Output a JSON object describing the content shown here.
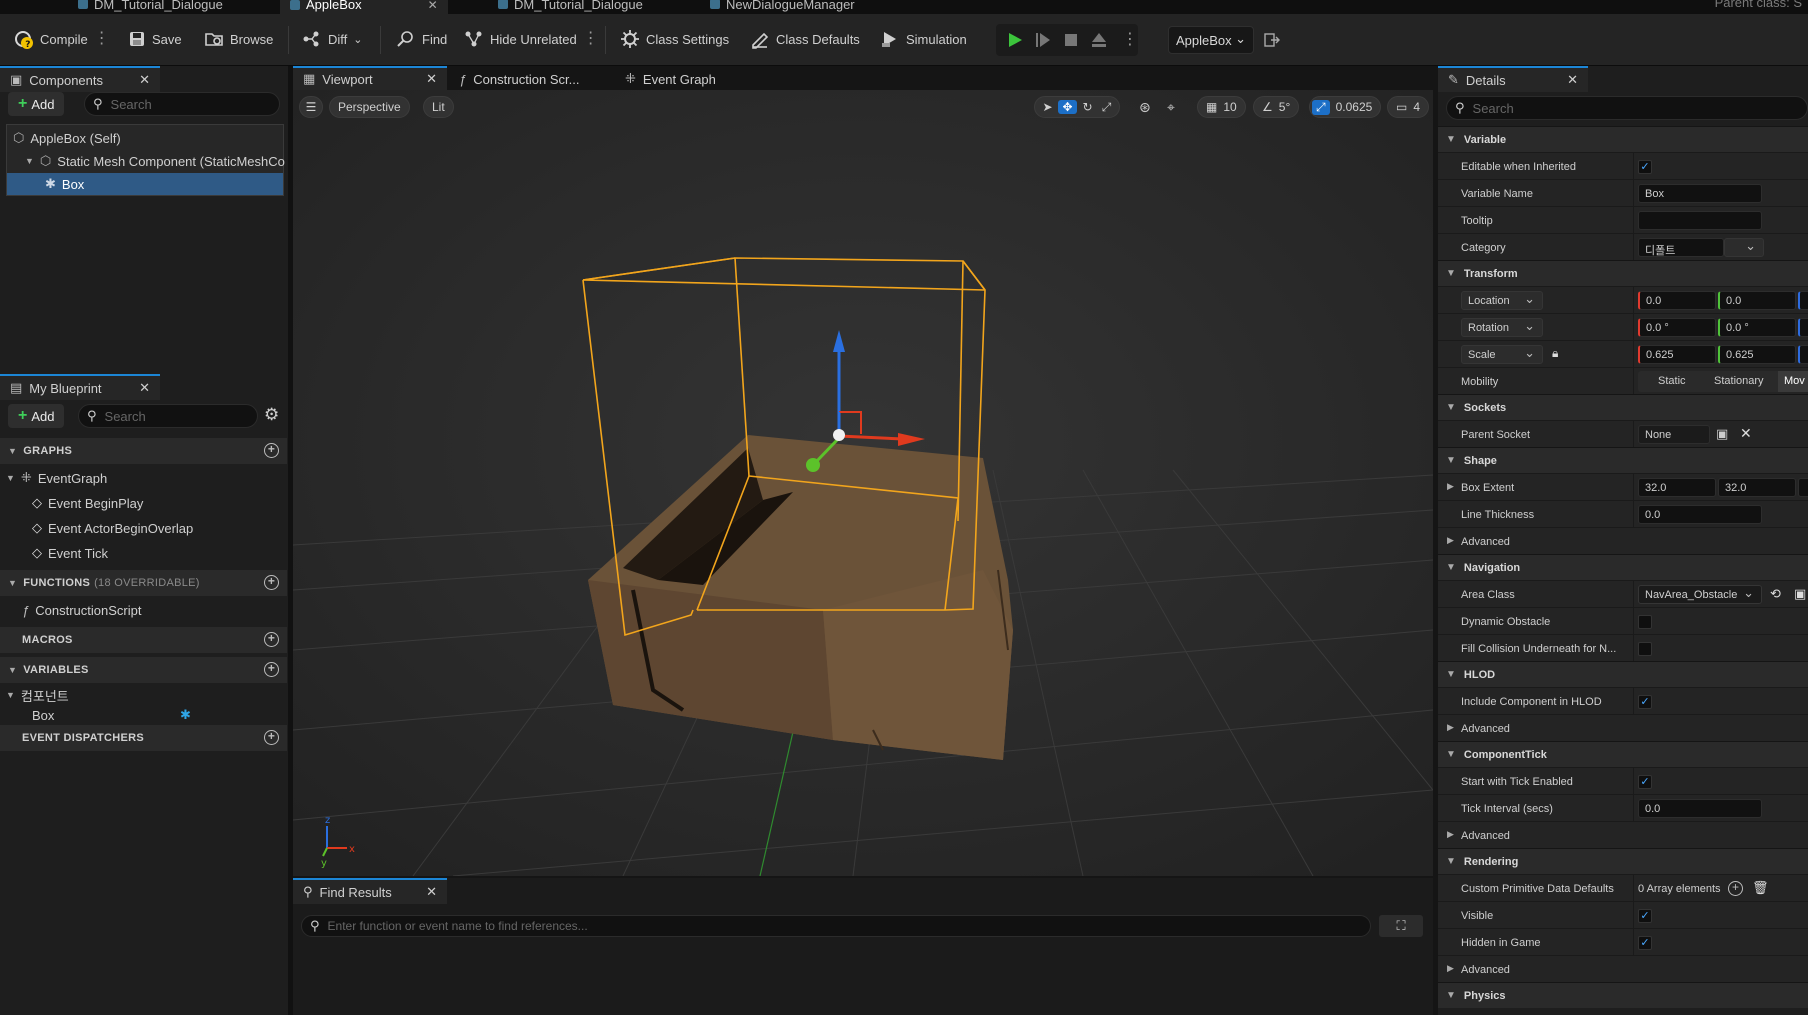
{
  "tabs": [
    {
      "label": "DM_Tutorial_Dialogue",
      "active": false
    },
    {
      "label": "AppleBox",
      "active": true
    },
    {
      "label": "DM_Tutorial_Dialogue",
      "active": false
    },
    {
      "label": "NewDialogueManager",
      "active": false
    }
  ],
  "parent_class": "Parent class: S",
  "toolbar": {
    "compile": "Compile",
    "save": "Save",
    "browse": "Browse",
    "diff": "Diff",
    "find": "Find",
    "hide_unrelated": "Hide Unrelated",
    "class_settings": "Class Settings",
    "class_defaults": "Class Defaults",
    "simulation": "Simulation",
    "debug_object": "AppleBox"
  },
  "components": {
    "tab": "Components",
    "add": "Add",
    "search_placeholder": "Search",
    "items": [
      "AppleBox (Self)",
      "Static Mesh Component (StaticMeshCo",
      "Box"
    ]
  },
  "my_blueprint": {
    "tab": "My Blueprint",
    "add": "Add",
    "search_placeholder": "Search",
    "graphs_header": "GRAPHS",
    "event_graph": "EventGraph",
    "events": [
      "Event BeginPlay",
      "Event ActorBeginOverlap",
      "Event Tick"
    ],
    "functions_header": "FUNCTIONS",
    "functions_note": "(18 OVERRIDABLE)",
    "construction_script": "ConstructionScript",
    "macros_header": "MACROS",
    "variables_header": "VARIABLES",
    "variable_category": "컴포넌트",
    "variable_box": "Box",
    "dispatchers_header": "EVENT DISPATCHERS"
  },
  "editor_tabs": {
    "viewport": "Viewport",
    "construction": "Construction Scr...",
    "event_graph": "Event Graph"
  },
  "viewport": {
    "perspective": "Perspective",
    "lit": "Lit",
    "grid_size": "10",
    "angle_snap": "5°",
    "scale_snap": "0.0625",
    "camera_speed": "4"
  },
  "find_results": {
    "tab": "Find Results",
    "placeholder": "Enter function or event name to find references..."
  },
  "details": {
    "tab": "Details",
    "search_placeholder": "Search",
    "variable_header": "Variable",
    "editable_label": "Editable when Inherited",
    "variable_name_label": "Variable Name",
    "variable_name_value": "Box",
    "tooltip_label": "Tooltip",
    "category_label": "Category",
    "category_value": "디폴트",
    "transform_header": "Transform",
    "location_label": "Location",
    "location_x": "0.0",
    "location_y": "0.0",
    "rotation_label": "Rotation",
    "rotation_x": "0.0 °",
    "rotation_y": "0.0 °",
    "scale_label": "Scale",
    "scale_x": "0.625",
    "scale_y": "0.625",
    "mobility_label": "Mobility",
    "mobility_static": "Static",
    "mobility_stationary": "Stationary",
    "mobility_movable": "Mov",
    "sockets_header": "Sockets",
    "parent_socket_label": "Parent Socket",
    "parent_socket_value": "None",
    "shape_header": "Shape",
    "box_extent_label": "Box Extent",
    "box_extent_x": "32.0",
    "box_extent_y": "32.0",
    "line_thickness_label": "Line Thickness",
    "line_thickness_value": "0.0",
    "advanced_label": "Advanced",
    "navigation_header": "Navigation",
    "area_class_label": "Area Class",
    "area_class_value": "NavArea_Obstacle",
    "dynamic_obstacle_label": "Dynamic Obstacle",
    "fill_collision_label": "Fill Collision Underneath for N...",
    "hlod_header": "HLOD",
    "include_hlod_label": "Include Component in HLOD",
    "component_tick_header": "ComponentTick",
    "start_tick_label": "Start with Tick Enabled",
    "tick_interval_label": "Tick Interval (secs)",
    "tick_interval_value": "0.0",
    "rendering_header": "Rendering",
    "custom_primitive_label": "Custom Primitive Data Defaults",
    "custom_primitive_value": "0 Array elements",
    "visible_label": "Visible",
    "hidden_in_game_label": "Hidden in Game",
    "physics_header": "Physics"
  },
  "checkbox_mark": "✓"
}
